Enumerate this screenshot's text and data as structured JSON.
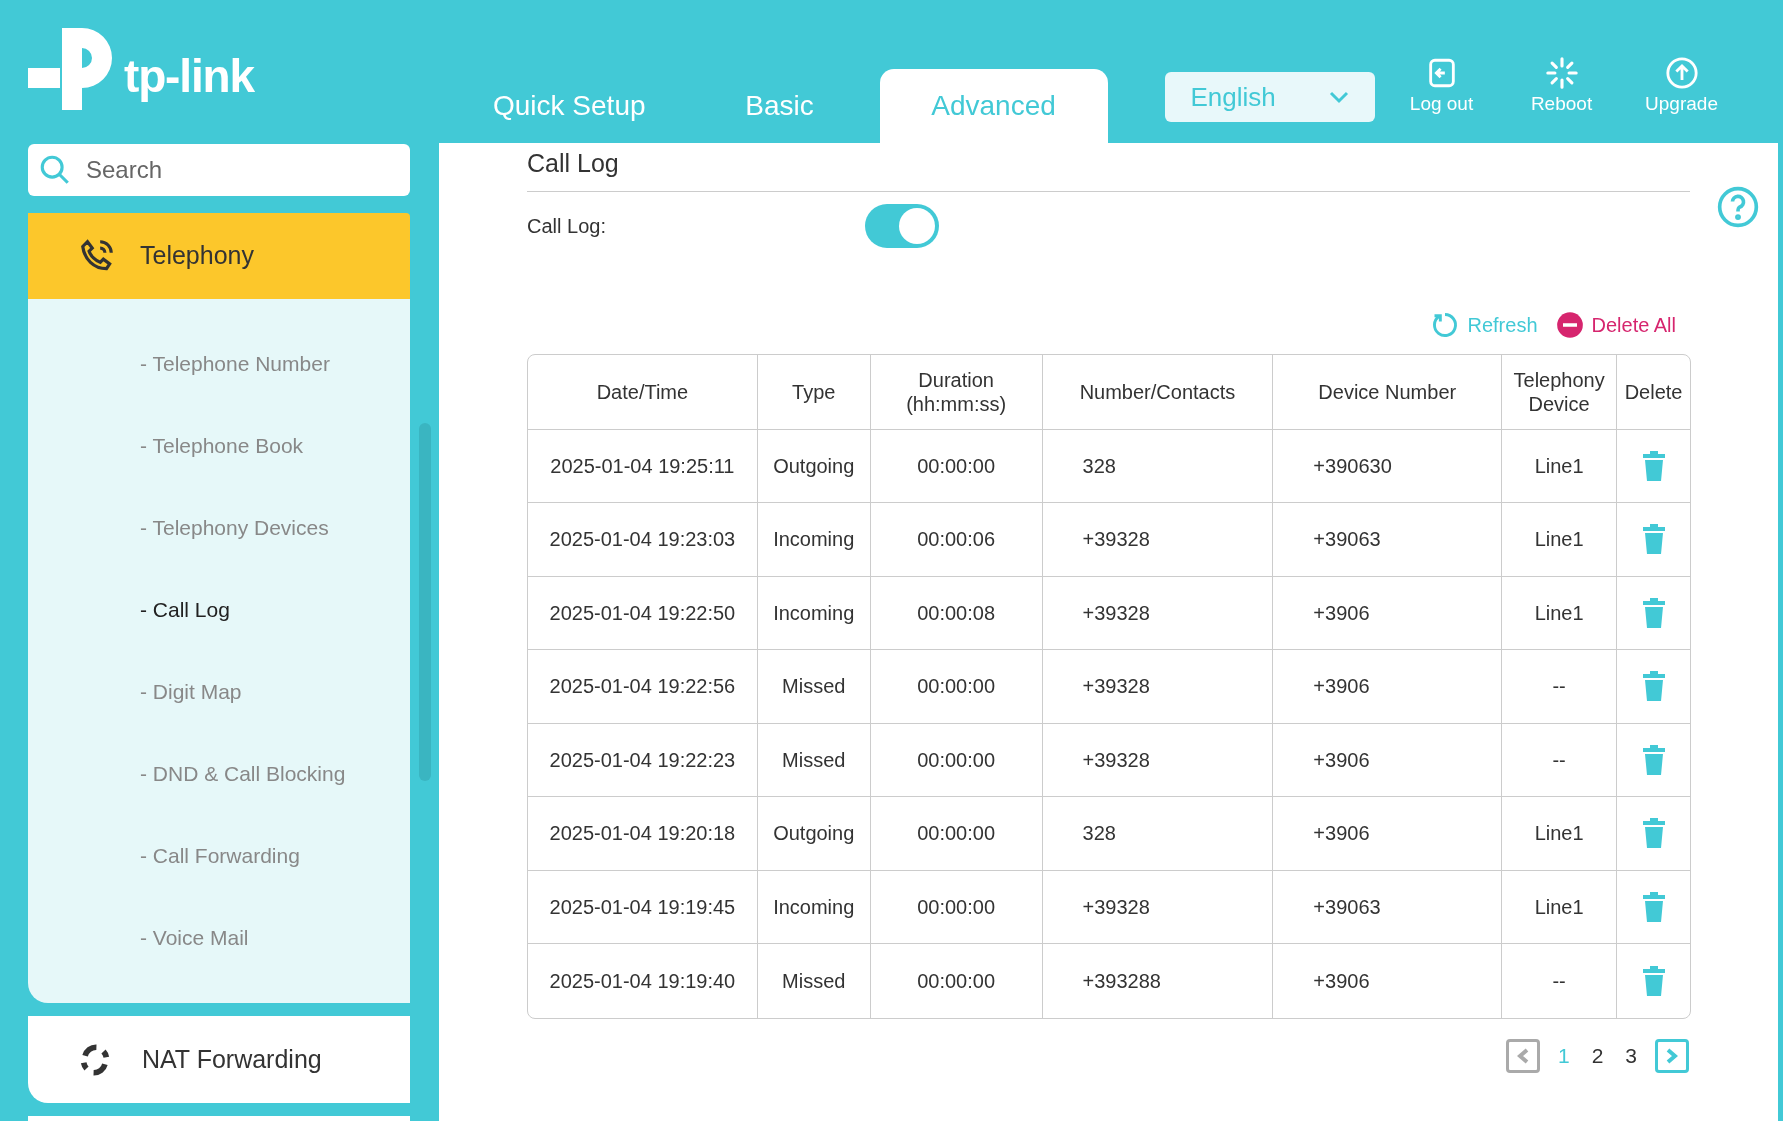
{
  "logo": {
    "text": "tp-link"
  },
  "tabs": [
    {
      "label": "Quick Setup",
      "selected": false
    },
    {
      "label": "Basic",
      "selected": false
    },
    {
      "label": "Advanced",
      "selected": true
    }
  ],
  "language": {
    "value": "English"
  },
  "header_actions": [
    {
      "kind": "logout",
      "label": "Log out"
    },
    {
      "kind": "reboot",
      "label": "Reboot"
    },
    {
      "kind": "upgrade",
      "label": "Upgrade"
    }
  ],
  "sidebar": {
    "search": {
      "placeholder": "Search"
    },
    "sections": [
      {
        "label": "Telephony",
        "kind": "phone",
        "expanded": true,
        "children": [
          {
            "label": "- Telephone Number",
            "selected": false
          },
          {
            "label": "- Telephone Book",
            "selected": false
          },
          {
            "label": "- Telephony Devices",
            "selected": false
          },
          {
            "label": "- Call Log",
            "selected": true
          },
          {
            "label": "- Digit Map",
            "selected": false
          },
          {
            "label": "- DND & Call Blocking",
            "selected": false
          },
          {
            "label": "- Call Forwarding",
            "selected": false
          },
          {
            "label": "- Voice Mail",
            "selected": false
          }
        ]
      },
      {
        "label": "NAT Forwarding",
        "kind": "nat",
        "expanded": false
      }
    ]
  },
  "main": {
    "title": "Call Log",
    "toggle": {
      "label": "Call Log:",
      "on": true
    },
    "actions": [
      {
        "kind": "refresh",
        "label": "Refresh"
      },
      {
        "kind": "delete",
        "label": "Delete All"
      }
    ],
    "table": {
      "columns": [
        "Date/Time",
        "Type",
        "Duration (hh:mm:ss)",
        "Number/Contacts",
        "Device Number",
        "Telephony Device",
        "Delete"
      ],
      "rows": [
        [
          "2025-01-04 19:25:11",
          "Outgoing",
          "00:00:00",
          "328",
          "+390630",
          "Line1"
        ],
        [
          "2025-01-04 19:23:03",
          "Incoming",
          "00:00:06",
          "+39328",
          "+39063",
          "Line1"
        ],
        [
          "2025-01-04 19:22:50",
          "Incoming",
          "00:00:08",
          "+39328",
          "+3906",
          "Line1"
        ],
        [
          "2025-01-04 19:22:56",
          "Missed",
          "00:00:00",
          "+39328",
          "+3906",
          "--"
        ],
        [
          "2025-01-04 19:22:23",
          "Missed",
          "00:00:00",
          "+39328",
          "+3906",
          "--"
        ],
        [
          "2025-01-04 19:20:18",
          "Outgoing",
          "00:00:00",
          "328",
          "+3906",
          "Line1"
        ],
        [
          "2025-01-04 19:19:45",
          "Incoming",
          "00:00:00",
          "+39328",
          "+39063",
          "Line1"
        ],
        [
          "2025-01-04 19:19:40",
          "Missed",
          "00:00:00",
          "+393288",
          "+3906",
          "--"
        ]
      ]
    },
    "pagination": {
      "pages": [
        {
          "label": "1",
          "selected": true
        },
        {
          "label": "2",
          "selected": false
        },
        {
          "label": "3",
          "selected": false
        }
      ],
      "prev_disabled": true,
      "next_disabled": false
    }
  }
}
